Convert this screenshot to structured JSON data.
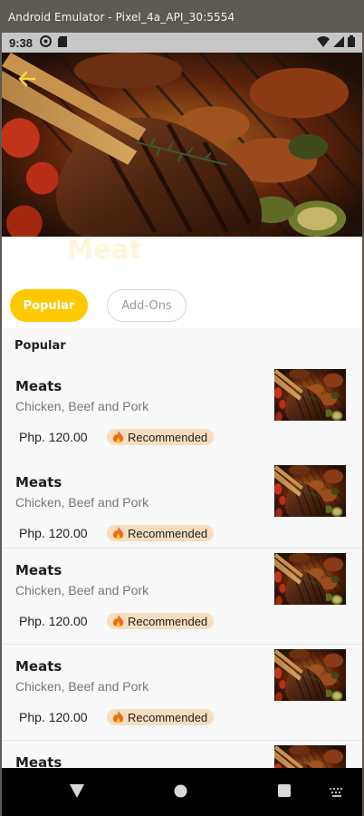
{
  "emulator": {
    "title": "Android Emulator - Pixel_4a_API_30:5554"
  },
  "status_bar": {
    "time": "9:38",
    "left_icons": [
      "data-saver-icon",
      "sd-card-icon"
    ],
    "right_icons": [
      "wifi-icon",
      "signal-icon",
      "battery-icon"
    ]
  },
  "page": {
    "title": "Meat",
    "back_icon": "back-arrow-icon",
    "accent_color": "#ffc800"
  },
  "tabs": [
    {
      "label": "Popular",
      "selected": true
    },
    {
      "label": "Add-Ons",
      "selected": false
    }
  ],
  "section": {
    "heading": "Popular"
  },
  "items": [
    {
      "name": "Meats",
      "description": "Chicken, Beef and Pork",
      "price": "Php. 120.00",
      "badge": "Recommended"
    },
    {
      "name": "Meats",
      "description": "Chicken, Beef and Pork",
      "price": "Php. 120.00",
      "badge": "Recommended"
    },
    {
      "name": "Meats",
      "description": "Chicken, Beef and Pork",
      "price": "Php. 120.00",
      "badge": "Recommended"
    },
    {
      "name": "Meats",
      "description": "Chicken, Beef and Pork",
      "price": "Php. 120.00",
      "badge": "Recommended"
    },
    {
      "name": "Meats",
      "description": "",
      "price": "",
      "badge": ""
    }
  ],
  "nav": {
    "buttons": [
      "back-triangle-icon",
      "home-circle-icon",
      "overview-square-icon",
      "keyboard-icon"
    ]
  }
}
